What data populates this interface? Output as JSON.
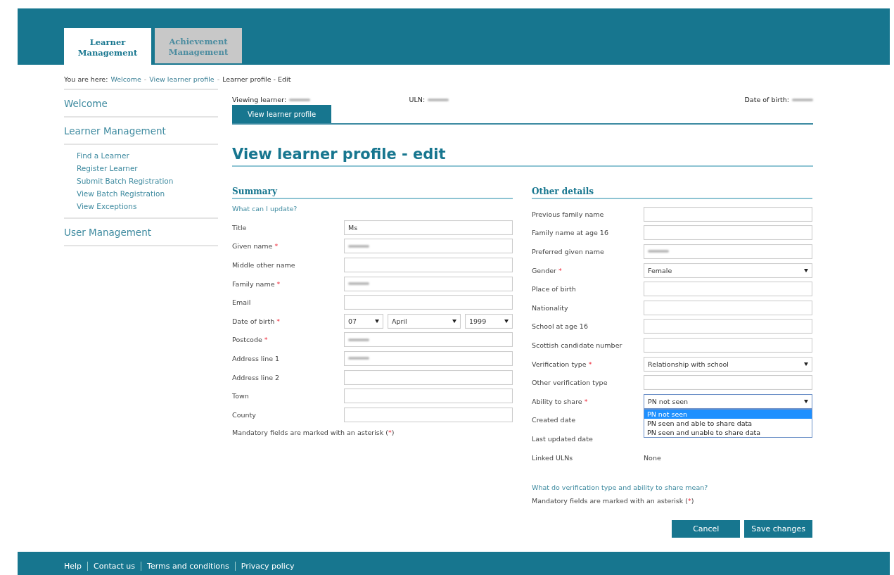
{
  "tabs": [
    {
      "label": "Learner Management",
      "selected": true
    },
    {
      "label": "Achievement Management",
      "selected": false
    }
  ],
  "breadcrumb": {
    "prefix": "You are here:",
    "links": [
      "Welcome",
      "View learner profile"
    ],
    "separator": "-",
    "current": "Learner profile - Edit"
  },
  "sidebar": {
    "items": [
      {
        "label": "Welcome"
      },
      {
        "label": "Learner Management",
        "children": [
          {
            "label": "Find a Learner"
          },
          {
            "label": "Register Learner"
          },
          {
            "label": "Submit Batch Registration"
          },
          {
            "label": "View Batch Registration"
          },
          {
            "label": "View Exceptions"
          }
        ]
      },
      {
        "label": "User Management"
      }
    ]
  },
  "learner_bar": [
    {
      "label": "Viewing learner:",
      "redacted": true
    },
    {
      "label": "ULN:",
      "redacted": true
    },
    {
      "label": "Date of birth:",
      "redacted": true
    }
  ],
  "subtabs": [
    {
      "label": "View learner profile",
      "selected": true
    }
  ],
  "page_title": "View learner profile - edit",
  "summary": {
    "heading": "Summary",
    "help_link": "What can I update?",
    "fields": [
      {
        "label": "Title",
        "kind": "text",
        "value": "Ms"
      },
      {
        "label": "Given name",
        "required": true,
        "kind": "text",
        "redacted": true
      },
      {
        "label": "Middle other name",
        "kind": "text"
      },
      {
        "label": "Family name",
        "required": true,
        "kind": "text",
        "redacted": true
      },
      {
        "label": "Email",
        "kind": "text"
      },
      {
        "label": "Date of birth",
        "required": true,
        "kind": "date",
        "parts": [
          "07",
          "April",
          "1999"
        ]
      },
      {
        "label": "Postcode",
        "required": true,
        "kind": "text",
        "redacted": true
      },
      {
        "label": "Address line 1",
        "kind": "text",
        "redacted": true
      },
      {
        "label": "Address line 2",
        "kind": "text"
      },
      {
        "label": "Town",
        "kind": "text"
      },
      {
        "label": "County",
        "kind": "text"
      }
    ],
    "note": {
      "text": "Mandatory fields are marked with an asterisk (",
      "mark": "*",
      "close": ")"
    }
  },
  "other": {
    "heading": "Other details",
    "fields": [
      {
        "label": "Previous family name",
        "kind": "text"
      },
      {
        "label": "Family name at age 16",
        "kind": "text"
      },
      {
        "label": "Preferred given name",
        "kind": "text",
        "redacted": true
      },
      {
        "label": "Gender",
        "required": true,
        "kind": "select",
        "value": "Female"
      },
      {
        "label": "Place of birth",
        "kind": "text"
      },
      {
        "label": "Nationality",
        "kind": "text"
      },
      {
        "label": "School at age 16",
        "kind": "text"
      },
      {
        "label": "Scottish candidate number",
        "kind": "text"
      },
      {
        "label": "Verification type",
        "required": true,
        "kind": "select",
        "value": "Relationship with school"
      },
      {
        "label": "Other verification type",
        "kind": "text"
      },
      {
        "label": "Ability to share",
        "required": true,
        "kind": "select",
        "value": "PN not seen",
        "expanded": true,
        "options": [
          {
            "label": "PN not seen",
            "selected": true
          },
          {
            "label": "PN seen and able to share data",
            "selected": false
          },
          {
            "label": "PN seen and unable to share data",
            "selected": false
          }
        ]
      },
      {
        "label": "Created date",
        "kind": "static"
      },
      {
        "label": "Last updated date",
        "kind": "static"
      },
      {
        "label": "Linked ULNs",
        "kind": "static",
        "value": "None"
      }
    ],
    "help_link": "What do verification type and ability to share mean?",
    "note": {
      "text": "Mandatory fields are marked with an asterisk (",
      "mark": "*",
      "close": ")"
    }
  },
  "buttons": [
    "Cancel",
    "Save changes"
  ],
  "footer_links": [
    "Help",
    "Contact us",
    "Terms and conditions",
    "Privacy policy"
  ]
}
